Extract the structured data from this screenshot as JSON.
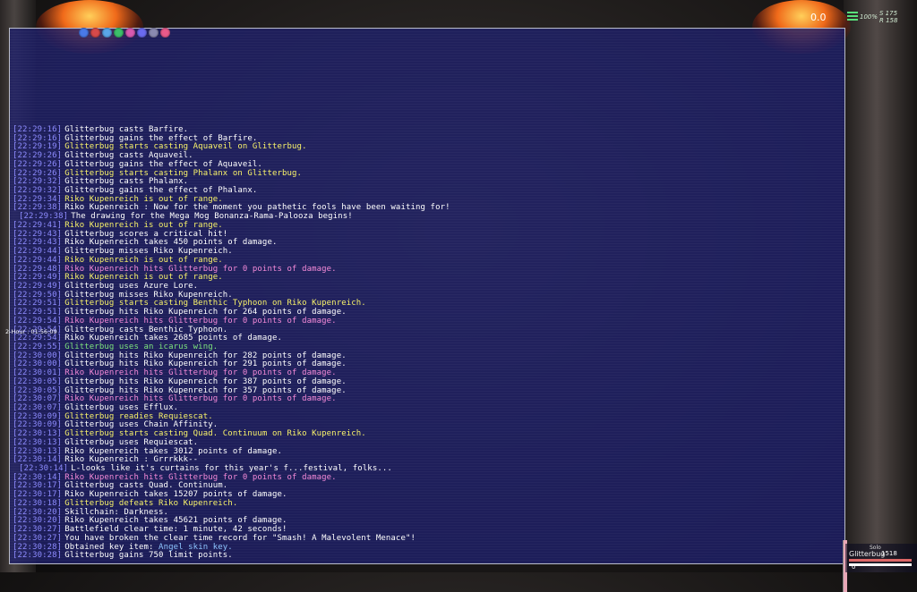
{
  "hud": {
    "top_value": "0.0",
    "signal_pct": "100%",
    "signal_s": "S 175",
    "signal_r": "R 158",
    "two_hour": "2-Hour : 01:56:09"
  },
  "party": {
    "solo_label": "Solo",
    "member_name": "Glitterbug",
    "hp": "1518",
    "tp": "0"
  },
  "colors": {
    "chat_bg": "#1e2069",
    "timestamp": "#8e8cff",
    "normal": "#ffffff",
    "spell": "#f8f26a",
    "damage_taken": "#f48ad8",
    "ability": "#7de47d"
  },
  "log": [
    {
      "ts": "[22:29:16]",
      "text": "Glitterbug casts Barfire.",
      "color": "white"
    },
    {
      "ts": "[22:29:16]",
      "text": "Glitterbug gains the effect of Barfire.",
      "color": "white"
    },
    {
      "ts": "[22:29:19]",
      "text": "Glitterbug starts casting Aquaveil on Glitterbug.",
      "color": "yellow"
    },
    {
      "ts": "[22:29:26]",
      "text": "Glitterbug casts Aquaveil.",
      "color": "white"
    },
    {
      "ts": "[22:29:26]",
      "text": "Glitterbug gains the effect of Aquaveil.",
      "color": "white"
    },
    {
      "ts": "[22:29:26]",
      "text": "Glitterbug starts casting Phalanx on Glitterbug.",
      "color": "yellow"
    },
    {
      "ts": "[22:29:32]",
      "text": "Glitterbug casts Phalanx.",
      "color": "white"
    },
    {
      "ts": "[22:29:32]",
      "text": "Glitterbug gains the effect of Phalanx.",
      "color": "white"
    },
    {
      "ts": "[22:29:34]",
      "text": "Riko Kupenreich is out of range.",
      "color": "yellow"
    },
    {
      "ts": "[22:29:38]",
      "text": "Riko Kupenreich : Now for the moment you pathetic fools have been waiting for!",
      "color": "white"
    },
    {
      "ts": "[22:29:38]",
      "text": "The drawing for the Mega Mog Bonanza-Rama-Palooza begins!",
      "color": "white",
      "indent": true
    },
    {
      "ts": "[22:29:41]",
      "text": "Riko Kupenreich is out of range.",
      "color": "yellow"
    },
    {
      "ts": "[22:29:43]",
      "text": "Glitterbug scores a critical hit!",
      "color": "white"
    },
    {
      "ts": "[22:29:43]",
      "text": "Riko Kupenreich takes 450 points of damage.",
      "color": "white"
    },
    {
      "ts": "[22:29:44]",
      "text": "Glitterbug misses Riko Kupenreich.",
      "color": "white"
    },
    {
      "ts": "[22:29:44]",
      "text": "Riko Kupenreich is out of range.",
      "color": "yellow"
    },
    {
      "ts": "[22:29:48]",
      "text": "Riko Kupenreich hits Glitterbug for 0 points of damage.",
      "color": "pink"
    },
    {
      "ts": "[22:29:49]",
      "text": "Riko Kupenreich is out of range.",
      "color": "yellow"
    },
    {
      "ts": "[22:29:49]",
      "text": "Glitterbug uses Azure Lore.",
      "color": "white"
    },
    {
      "ts": "[22:29:50]",
      "text": "Glitterbug misses Riko Kupenreich.",
      "color": "white"
    },
    {
      "ts": "[22:29:51]",
      "text": "Glitterbug starts casting Benthic Typhoon on Riko Kupenreich.",
      "color": "yellow"
    },
    {
      "ts": "[22:29:51]",
      "text": "Glitterbug hits Riko Kupenreich for 264 points of damage.",
      "color": "white"
    },
    {
      "ts": "[22:29:54]",
      "text": "Riko Kupenreich hits Glitterbug for 0 points of damage.",
      "color": "pink"
    },
    {
      "ts": "[22:29:54]",
      "text": "Glitterbug casts Benthic Typhoon.",
      "color": "white"
    },
    {
      "ts": "[22:29:54]",
      "text": "Riko Kupenreich takes 2685 points of damage.",
      "color": "white"
    },
    {
      "ts": "[22:29:55]",
      "text": "Glitterbug uses an icarus wing.",
      "color": "green"
    },
    {
      "ts": "[22:30:00]",
      "text": "Glitterbug hits Riko Kupenreich for 282 points of damage.",
      "color": "white"
    },
    {
      "ts": "[22:30:00]",
      "text": "Glitterbug hits Riko Kupenreich for 291 points of damage.",
      "color": "white"
    },
    {
      "ts": "[22:30:01]",
      "text": "Riko Kupenreich hits Glitterbug for 0 points of damage.",
      "color": "pink"
    },
    {
      "ts": "[22:30:05]",
      "text": "Glitterbug hits Riko Kupenreich for 387 points of damage.",
      "color": "white"
    },
    {
      "ts": "[22:30:05]",
      "text": "Glitterbug hits Riko Kupenreich for 357 points of damage.",
      "color": "white"
    },
    {
      "ts": "[22:30:07]",
      "text": "Riko Kupenreich hits Glitterbug for 0 points of damage.",
      "color": "pink"
    },
    {
      "ts": "[22:30:07]",
      "text": "Glitterbug uses Efflux.",
      "color": "white"
    },
    {
      "ts": "[22:30:09]",
      "text": "Glitterbug readies Requiescat.",
      "color": "yellow"
    },
    {
      "ts": "[22:30:09]",
      "text": "Glitterbug uses Chain Affinity.",
      "color": "white"
    },
    {
      "ts": "[22:30:13]",
      "text": "Glitterbug starts casting Quad. Continuum on Riko Kupenreich.",
      "color": "yellow"
    },
    {
      "ts": "[22:30:13]",
      "text": "Glitterbug uses Requiescat.",
      "color": "white"
    },
    {
      "ts": "[22:30:13]",
      "text": "Riko Kupenreich takes 3012 points of damage.",
      "color": "white"
    },
    {
      "ts": "[22:30:14]",
      "text": "Riko Kupenreich : Grrrkkk--",
      "color": "white"
    },
    {
      "ts": "[22:30:14]",
      "text": "L-looks like it's curtains for this year's f...festival, folks...",
      "color": "white",
      "indent": true
    },
    {
      "ts": "[22:30:14]",
      "text": "Riko Kupenreich hits Glitterbug for 0 points of damage.",
      "color": "pink"
    },
    {
      "ts": "[22:30:17]",
      "text": "Glitterbug casts Quad. Continuum.",
      "color": "white"
    },
    {
      "ts": "[22:30:17]",
      "text": "Riko Kupenreich takes 15207 points of damage.",
      "color": "white"
    },
    {
      "ts": "[22:30:18]",
      "text": "Glitterbug defeats Riko Kupenreich.",
      "color": "yellow"
    },
    {
      "ts": "[22:30:20]",
      "text": "Skillchain: Darkness.",
      "color": "white"
    },
    {
      "ts": "[22:30:20]",
      "text": "Riko Kupenreich takes 45621 points of damage.",
      "color": "white"
    },
    {
      "ts": "[22:30:27]",
      "text": "Battlefield clear time: 1 minute, 42 seconds!",
      "color": "white"
    },
    {
      "ts": "[22:30:27]",
      "text": "You have broken the clear time record for \"Smash! A Malevolent Menace\"!",
      "color": "white"
    },
    {
      "ts": "[22:30:28]",
      "text": "Obtained key item: ",
      "key": "Angel skin key.",
      "color": "white"
    },
    {
      "ts": "[22:30:28]",
      "text": "Glitterbug gains 750 limit points.",
      "color": "white"
    }
  ]
}
